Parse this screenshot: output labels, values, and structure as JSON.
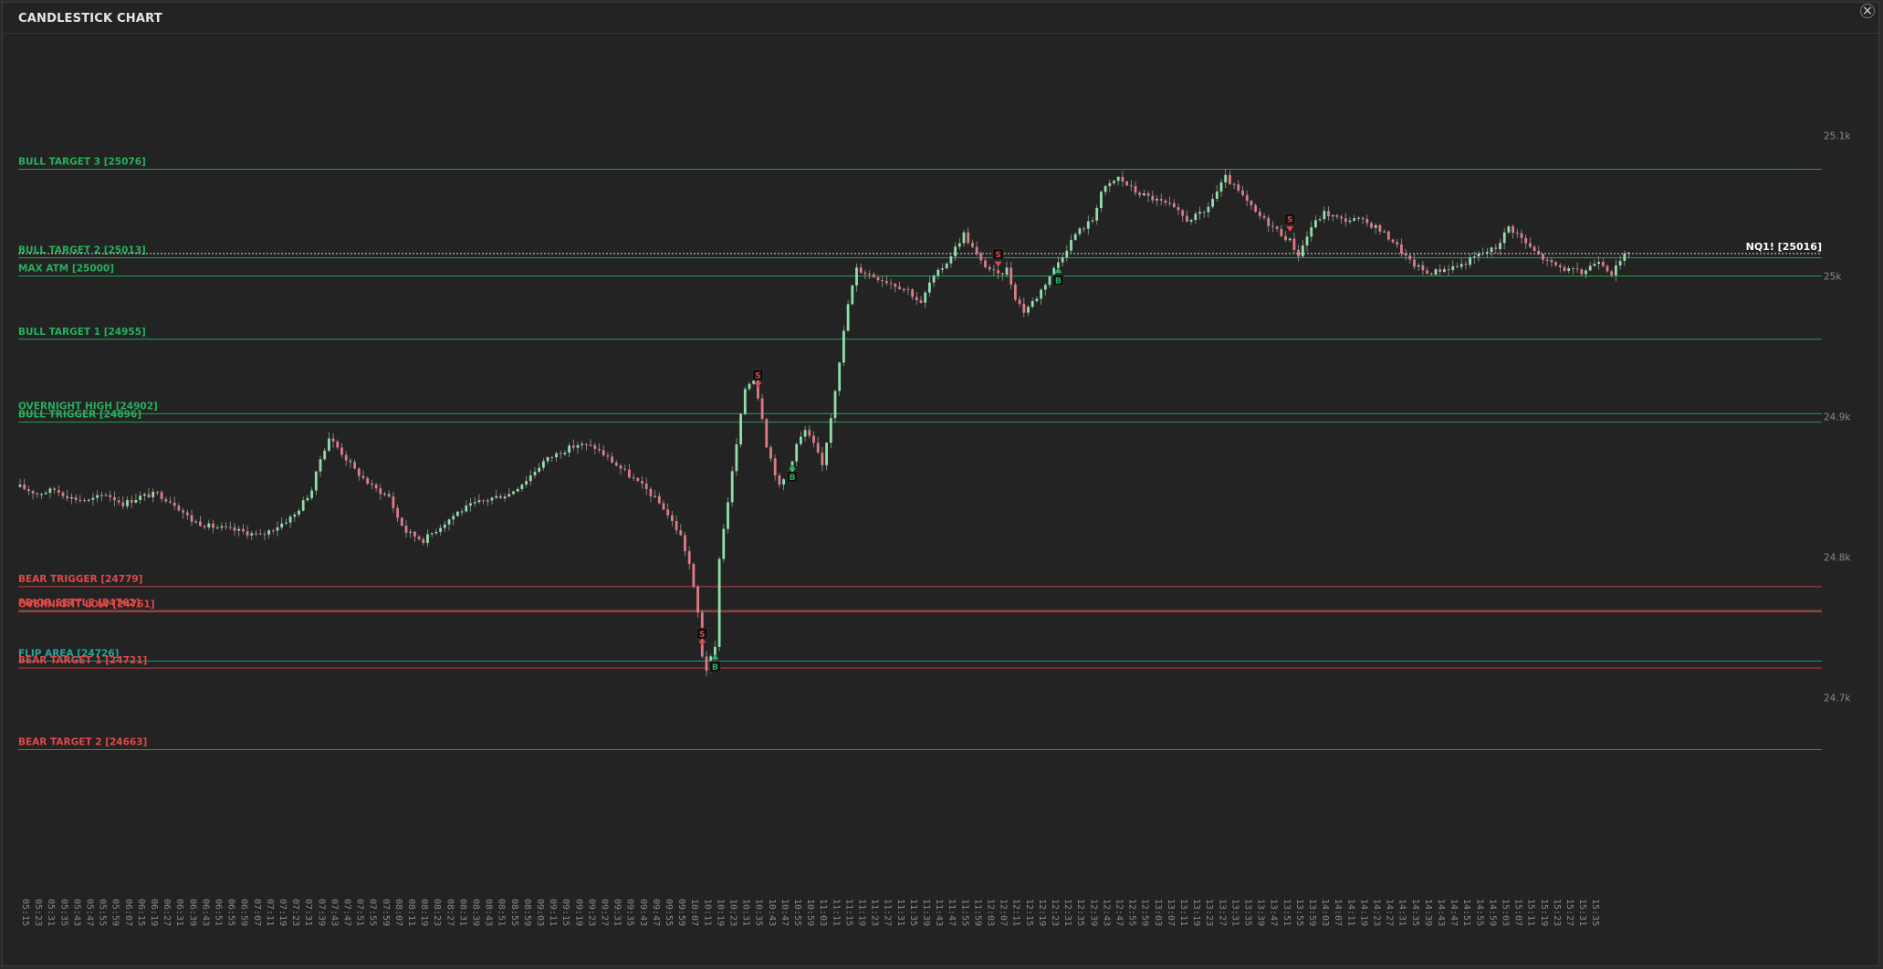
{
  "window": {
    "title": "CANDLESTICK CHART",
    "close_label": "×"
  },
  "colors": {
    "background": "#232323",
    "bull": "#26b05c",
    "bear": "#e04848",
    "neutral": "#26a69a",
    "candle_up": "#8ee0a8",
    "candle_down": "#e07a86",
    "wick": "#9a9a9a",
    "axis_text": "#8a8a8a",
    "current_line": "#d8d8d8"
  },
  "chart_data": {
    "type": "candlestick",
    "title": "CANDLESTICK CHART",
    "symbol": "NQ1!",
    "ylim": [
      24625,
      25125
    ],
    "y_ticks": [
      {
        "value": 25100,
        "label": "25.1k"
      },
      {
        "value": 25000,
        "label": "25k"
      },
      {
        "value": 24900,
        "label": "24.9k"
      },
      {
        "value": 24800,
        "label": "24.8k"
      },
      {
        "value": 24700,
        "label": "24.7k"
      }
    ],
    "current_price": {
      "label": "NQ1! [25016]",
      "value": 25016
    },
    "levels": [
      {
        "label": "BULL TARGET 3 [25076]",
        "value": 25076,
        "kind": "bull"
      },
      {
        "label": "BULL TARGET 2 [25013]",
        "value": 25013,
        "kind": "bull"
      },
      {
        "label": "MAX ATM [25000]",
        "value": 25000,
        "kind": "bull"
      },
      {
        "label": "BULL TARGET 1 [24955]",
        "value": 24955,
        "kind": "bull"
      },
      {
        "label": "OVERNIGHT HIGH [24902]",
        "value": 24902,
        "kind": "bull"
      },
      {
        "label": "BULL TRIGGER [24896]",
        "value": 24896,
        "kind": "bull"
      },
      {
        "label": "BEAR TRIGGER [24779]",
        "value": 24779,
        "kind": "bear"
      },
      {
        "label": "PRIOR SETTLE [24762]",
        "value": 24762,
        "kind": "bear"
      },
      {
        "label": "OVERNIGHT LOW [24761]",
        "value": 24761,
        "kind": "bear"
      },
      {
        "label": "FLIP AREA [24726]",
        "value": 24726,
        "kind": "neutral"
      },
      {
        "label": "BEAR TARGET 1 [24721]",
        "value": 24721,
        "kind": "bear"
      },
      {
        "label": "BEAR TARGET 2 [24663]",
        "value": 24663,
        "kind": "bear"
      }
    ],
    "x_ticks": [
      "05:15",
      "05:23",
      "05:31",
      "05:35",
      "05:43",
      "05:47",
      "05:55",
      "05:59",
      "06:07",
      "06:15",
      "06:19",
      "06:27",
      "06:31",
      "06:39",
      "06:43",
      "06:51",
      "06:55",
      "06:59",
      "07:07",
      "07:11",
      "07:19",
      "07:23",
      "07:31",
      "07:39",
      "07:43",
      "07:47",
      "07:51",
      "07:55",
      "07:59",
      "08:07",
      "08:11",
      "08:19",
      "08:23",
      "08:27",
      "08:31",
      "08:39",
      "08:43",
      "08:51",
      "08:55",
      "08:59",
      "09:03",
      "09:11",
      "09:15",
      "09:19",
      "09:23",
      "09:27",
      "09:31",
      "09:35",
      "09:43",
      "09:47",
      "09:55",
      "09:59",
      "10:07",
      "10:11",
      "10:19",
      "10:23",
      "10:31",
      "10:35",
      "10:43",
      "10:47",
      "10:55",
      "10:59",
      "11:03",
      "11:11",
      "11:15",
      "11:19",
      "11:23",
      "11:27",
      "11:31",
      "11:35",
      "11:39",
      "11:43",
      "11:47",
      "11:55",
      "11:59",
      "12:03",
      "12:07",
      "12:11",
      "12:15",
      "12:19",
      "12:23",
      "12:31",
      "12:35",
      "12:39",
      "12:43",
      "12:47",
      "12:55",
      "12:59",
      "13:03",
      "13:07",
      "13:11",
      "13:19",
      "13:23",
      "13:27",
      "13:31",
      "13:35",
      "13:39",
      "13:47",
      "13:51",
      "13:55",
      "13:59",
      "14:03",
      "14:07",
      "14:11",
      "14:19",
      "14:23",
      "14:27",
      "14:31",
      "14:35",
      "14:39",
      "14:43",
      "14:47",
      "14:51",
      "14:55",
      "14:59",
      "15:03",
      "15:07",
      "15:11",
      "15:19",
      "15:23",
      "15:27",
      "15:31",
      "15:35"
    ],
    "price_path": [
      [
        0,
        24850
      ],
      [
        4,
        24845
      ],
      [
        8,
        24848
      ],
      [
        12,
        24842
      ],
      [
        16,
        24840
      ],
      [
        20,
        24845
      ],
      [
        24,
        24838
      ],
      [
        28,
        24843
      ],
      [
        32,
        24845
      ],
      [
        36,
        24838
      ],
      [
        40,
        24826
      ],
      [
        44,
        24822
      ],
      [
        48,
        24820
      ],
      [
        52,
        24818
      ],
      [
        56,
        24815
      ],
      [
        60,
        24822
      ],
      [
        64,
        24830
      ],
      [
        68,
        24848
      ],
      [
        70,
        24870
      ],
      [
        72,
        24885
      ],
      [
        74,
        24878
      ],
      [
        78,
        24862
      ],
      [
        82,
        24850
      ],
      [
        86,
        24843
      ],
      [
        88,
        24828
      ],
      [
        90,
        24818
      ],
      [
        94,
        24812
      ],
      [
        98,
        24822
      ],
      [
        102,
        24832
      ],
      [
        106,
        24838
      ],
      [
        110,
        24842
      ],
      [
        114,
        24845
      ],
      [
        118,
        24855
      ],
      [
        122,
        24868
      ],
      [
        126,
        24875
      ],
      [
        130,
        24880
      ],
      [
        134,
        24878
      ],
      [
        138,
        24868
      ],
      [
        142,
        24858
      ],
      [
        146,
        24848
      ],
      [
        150,
        24835
      ],
      [
        154,
        24815
      ],
      [
        156,
        24795
      ],
      [
        158,
        24760
      ],
      [
        159,
        24730
      ],
      [
        160,
        24720
      ],
      [
        162,
        24735
      ],
      [
        163,
        24800
      ],
      [
        165,
        24840
      ],
      [
        167,
        24880
      ],
      [
        169,
        24920
      ],
      [
        171,
        24928
      ],
      [
        173,
        24900
      ],
      [
        174,
        24880
      ],
      [
        176,
        24860
      ],
      [
        177,
        24850
      ],
      [
        179,
        24860
      ],
      [
        181,
        24880
      ],
      [
        183,
        24890
      ],
      [
        185,
        24880
      ],
      [
        187,
        24865
      ],
      [
        189,
        24900
      ],
      [
        191,
        24940
      ],
      [
        193,
        24980
      ],
      [
        195,
        25005
      ],
      [
        199,
        25000
      ],
      [
        203,
        24995
      ],
      [
        207,
        24990
      ],
      [
        210,
        24980
      ],
      [
        212,
        24995
      ],
      [
        216,
        25010
      ],
      [
        220,
        25030
      ],
      [
        224,
        25010
      ],
      [
        228,
        25000
      ],
      [
        230,
        25005
      ],
      [
        232,
        24985
      ],
      [
        234,
        24975
      ],
      [
        237,
        24985
      ],
      [
        240,
        25000
      ],
      [
        242,
        25010
      ],
      [
        246,
        25030
      ],
      [
        250,
        25040
      ],
      [
        252,
        25060
      ],
      [
        256,
        25070
      ],
      [
        260,
        25060
      ],
      [
        264,
        25055
      ],
      [
        268,
        25050
      ],
      [
        272,
        25040
      ],
      [
        276,
        25045
      ],
      [
        279,
        25060
      ],
      [
        281,
        25070
      ],
      [
        284,
        25060
      ],
      [
        288,
        25045
      ],
      [
        292,
        25035
      ],
      [
        296,
        25025
      ],
      [
        298,
        25015
      ],
      [
        301,
        25035
      ],
      [
        304,
        25045
      ],
      [
        308,
        25040
      ],
      [
        312,
        25040
      ],
      [
        316,
        25035
      ],
      [
        320,
        25025
      ],
      [
        324,
        25010
      ],
      [
        328,
        25002
      ],
      [
        332,
        25005
      ],
      [
        336,
        25008
      ],
      [
        340,
        25015
      ],
      [
        344,
        25020
      ],
      [
        347,
        25035
      ],
      [
        349,
        25030
      ],
      [
        352,
        25020
      ],
      [
        356,
        25010
      ],
      [
        360,
        25005
      ],
      [
        364,
        25002
      ],
      [
        368,
        25012
      ],
      [
        371,
        25002
      ],
      [
        373,
        25010
      ],
      [
        375,
        25018
      ]
    ],
    "markers": [
      {
        "i": 159,
        "label": "S",
        "kind": "sell"
      },
      {
        "i": 162,
        "label": "B",
        "kind": "buy"
      },
      {
        "i": 172,
        "label": "S",
        "kind": "sell"
      },
      {
        "i": 180,
        "label": "B",
        "kind": "buy"
      },
      {
        "i": 228,
        "label": "S",
        "kind": "sell"
      },
      {
        "i": 242,
        "label": "B",
        "kind": "buy"
      },
      {
        "i": 296,
        "label": "S",
        "kind": "sell"
      }
    ]
  }
}
